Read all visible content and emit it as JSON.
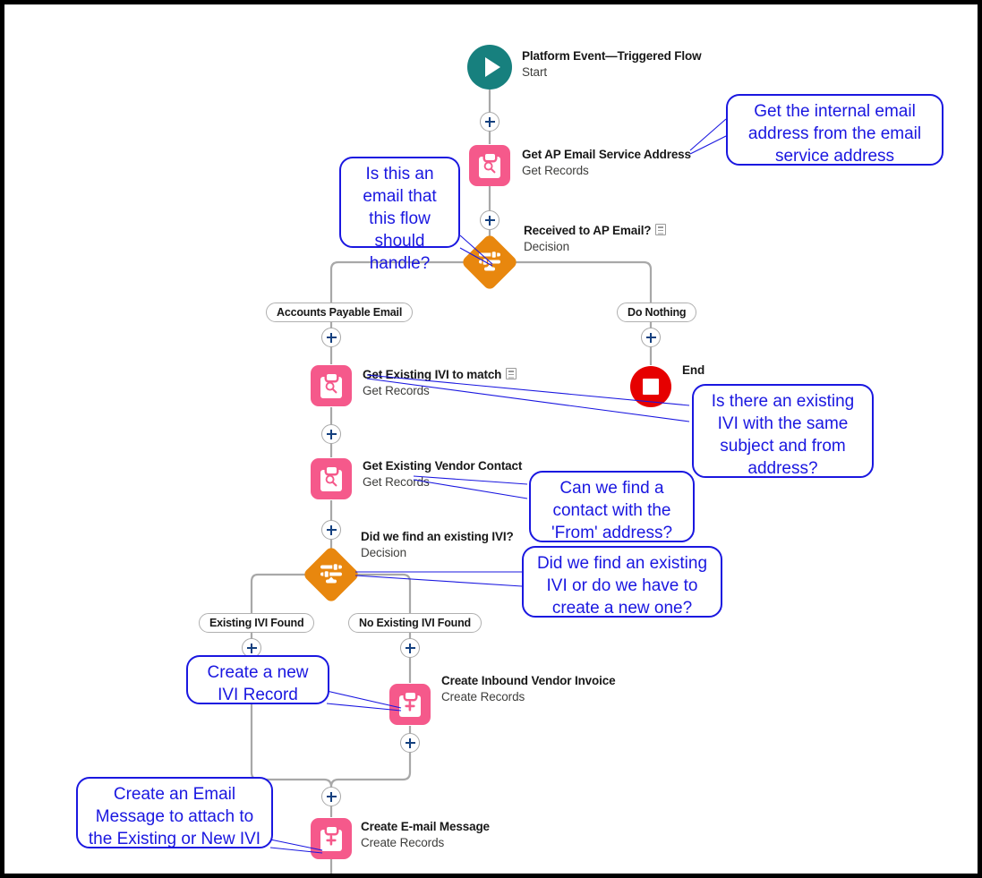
{
  "diagram": {
    "title": "Salesforce Flow Builder Canvas",
    "colors": {
      "start": "#17807E",
      "end": "#E60000",
      "record_node": "#F5598B",
      "decision": "#E8870E",
      "connector": "#A8A8A8",
      "annotation": "#1A17E0",
      "plus_glyph": "#14407F"
    }
  },
  "nodes": [
    {
      "id": "start",
      "type": "start",
      "title": "Platform Event—Triggered Flow",
      "subtitle": "Start",
      "icon": "play-icon",
      "has_note": false
    },
    {
      "id": "get-ap-email-service-address",
      "type": "get-records",
      "title": "Get AP Email Service Address",
      "subtitle": "Get Records",
      "icon": "clipboard-search-icon",
      "has_note": false
    },
    {
      "id": "received-to-ap-email",
      "type": "decision",
      "title": "Received to AP Email?",
      "subtitle": "Decision",
      "icon": "decision-sliders-icon",
      "has_note": true
    },
    {
      "id": "get-existing-ivi-to-match",
      "type": "get-records",
      "title": "Get Existing IVI to match",
      "subtitle": "Get Records",
      "icon": "clipboard-search-icon",
      "has_note": true
    },
    {
      "id": "end",
      "type": "end",
      "title": "End",
      "subtitle": "",
      "icon": "stop-square-icon",
      "has_note": false
    },
    {
      "id": "get-existing-vendor-contact",
      "type": "get-records",
      "title": "Get Existing Vendor Contact",
      "subtitle": "Get Records",
      "icon": "clipboard-search-icon",
      "has_note": false
    },
    {
      "id": "did-we-find-an-existing-ivi",
      "type": "decision",
      "title": "Did we find an existing IVI?",
      "subtitle": "Decision",
      "icon": "decision-sliders-icon",
      "has_note": false
    },
    {
      "id": "create-inbound-vendor-invoice",
      "type": "create-records",
      "title": "Create Inbound Vendor Invoice",
      "subtitle": "Create Records",
      "icon": "clipboard-plus-icon",
      "has_note": false
    },
    {
      "id": "create-email-message",
      "type": "create-records",
      "title": "Create E-mail Message",
      "subtitle": "Create Records",
      "icon": "clipboard-plus-icon",
      "has_note": false
    }
  ],
  "branch_labels": [
    {
      "id": "accounts-payable-email",
      "label": "Accounts Payable Email"
    },
    {
      "id": "do-nothing",
      "label": "Do Nothing"
    },
    {
      "id": "existing-ivi-found",
      "label": "Existing IVI Found"
    },
    {
      "id": "no-existing-ivi-found",
      "label": "No Existing IVI Found"
    }
  ],
  "annotations": [
    {
      "id": "annotation-internal-email",
      "text": "Get the internal email address from the email service address"
    },
    {
      "id": "annotation-should-handle",
      "text": "Is this an email that this flow should handle?"
    },
    {
      "id": "annotation-existing-ivi",
      "text": "Is there an existing IVI with the same subject and from address?"
    },
    {
      "id": "annotation-find-contact",
      "text": "Can we find a contact with the 'From' address?"
    },
    {
      "id": "annotation-find-or-create",
      "text": "Did we find an existing IVI or do we have to create a new one?"
    },
    {
      "id": "annotation-create-ivi",
      "text": "Create a new IVI Record"
    },
    {
      "id": "annotation-create-email-message",
      "text": "Create an Email Message to attach to the Existing or New IVI"
    }
  ]
}
